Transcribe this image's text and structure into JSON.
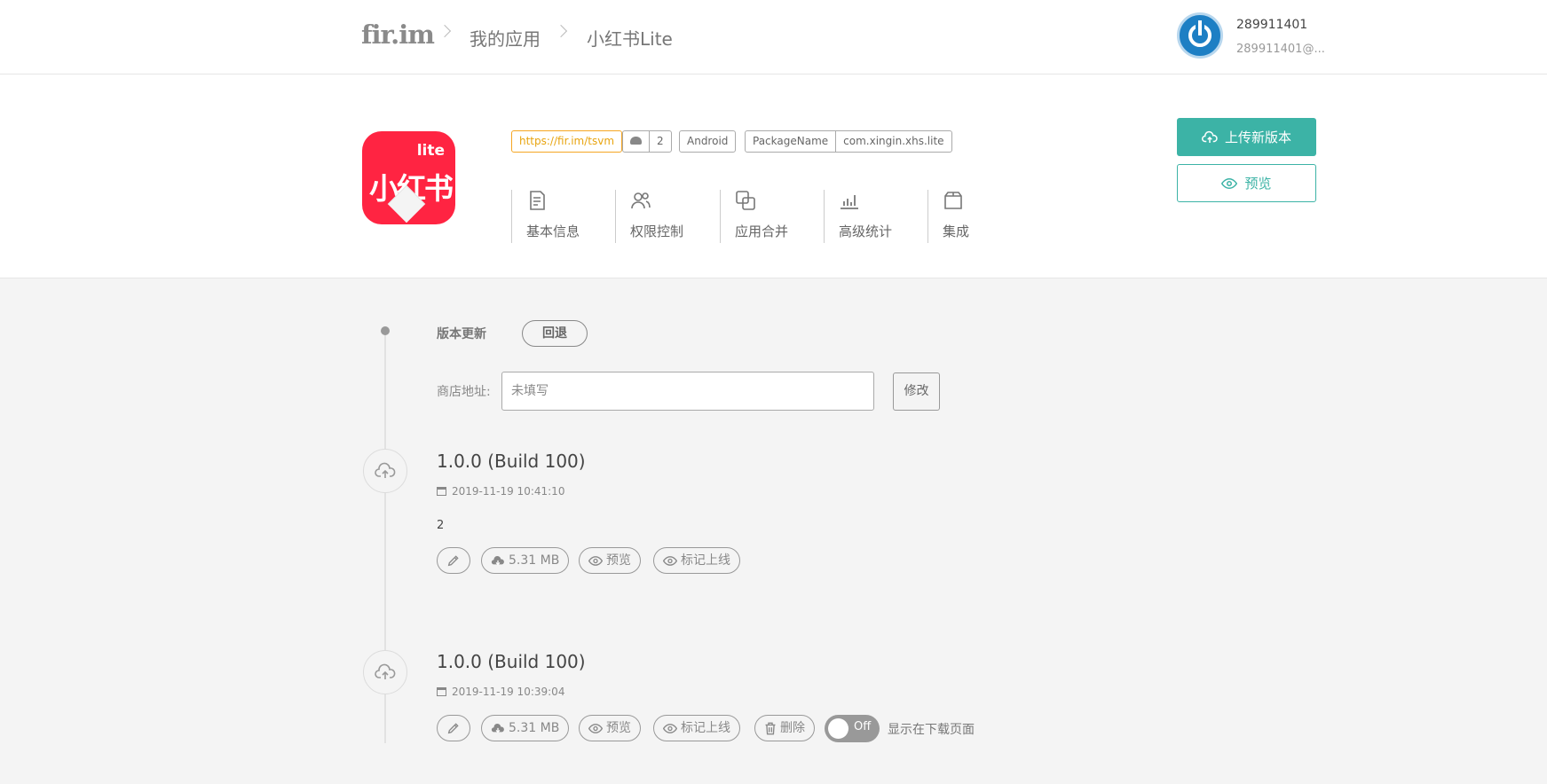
{
  "topbar": {
    "logo": "fir.im",
    "breadcrumb": [
      "我的应用",
      "小红书Lite"
    ],
    "user": {
      "name": "289911401",
      "email": "289911401@..."
    }
  },
  "app": {
    "icon_text_main": "小红书",
    "icon_text_sub": "lite",
    "short_link": "https://fir.im/tsvm",
    "download_count": "2",
    "platform": "Android",
    "package_label": "PackageName",
    "package_name": "com.xingin.xhs.lite",
    "nav": [
      "基本信息",
      "权限控制",
      "应用合并",
      "高级统计",
      "集成"
    ],
    "upload_label": "上传新版本",
    "preview_label": "预览"
  },
  "timeline": {
    "section_title": "版本更新",
    "rollback_label": "回退",
    "store_label": "商店地址:",
    "store_placeholder": "未填写",
    "edit_label": "修改",
    "versions": [
      {
        "title": "1.0.0 (Build 100)",
        "date": "2019-11-19 10:41:10",
        "note": "2",
        "size": "5.31 MB",
        "preview": "预览",
        "mark_online": "标记上线"
      },
      {
        "title": "1.0.0 (Build 100)",
        "date": "2019-11-19 10:39:04",
        "size": "5.31 MB",
        "preview": "预览",
        "mark_online": "标记上线",
        "delete": "删除",
        "toggle_state": "Off",
        "toggle_desc": "显示在下载页面"
      }
    ]
  },
  "colors": {
    "accent": "#3cb3a6",
    "app_icon": "#ff2442",
    "link_tag": "#f5a623"
  }
}
